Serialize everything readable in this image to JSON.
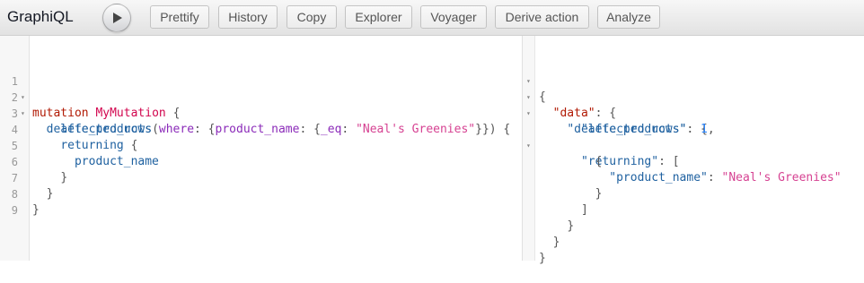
{
  "app": {
    "title": "GraphiQL"
  },
  "toolbar": {
    "execute_icon": "play-icon",
    "buttons": [
      "Prettify",
      "History",
      "Copy",
      "Explorer",
      "Voyager",
      "Derive action",
      "Analyze"
    ]
  },
  "query_editor": {
    "line_numbers": [
      "1",
      "2",
      "3",
      "4",
      "5",
      "6",
      "7",
      "8",
      "9"
    ],
    "fold_marker": "▾",
    "tokens": {
      "mutation": "mutation",
      "name": "MyMutation",
      "open": "{",
      "field": "delete_products",
      "paren_open": "(",
      "where": "where",
      "colon_brace": ": {",
      "product_name_arg": "product_name",
      "colon_brace2": ": {",
      "eq": "_eq",
      "colon": ": ",
      "eq_value": "\"Neal's Greenies\"",
      "close_args": "}}) {",
      "affected_rows": "affected_rows",
      "returning": "returning",
      "returning_open": " {",
      "product_name": "product_name",
      "close": "}"
    }
  },
  "result_viewer": {
    "fold_marker": "▾",
    "tokens": {
      "open": "{",
      "data_key": "\"data\"",
      "delete_products_key": "\"delete_products\"",
      "affected_rows_key": "\"affected_rows\"",
      "affected_rows_value": "1",
      "returning_key": "\"returning\"",
      "product_name_key": "\"product_name\"",
      "product_name_value": "\"Neal's Greenies\"",
      "obj_open": ": {",
      "arr_open": ": [",
      "colon": ": ",
      "comma": ",",
      "brace_open": "{",
      "brace_close": "}",
      "bracket_close": "]"
    }
  },
  "colors": {
    "keyword": "#b11a04",
    "definition": "#d2054e",
    "property": "#1f61a0",
    "attribute": "#8b2bb9",
    "string": "#d64292",
    "number": "#2882f9"
  }
}
